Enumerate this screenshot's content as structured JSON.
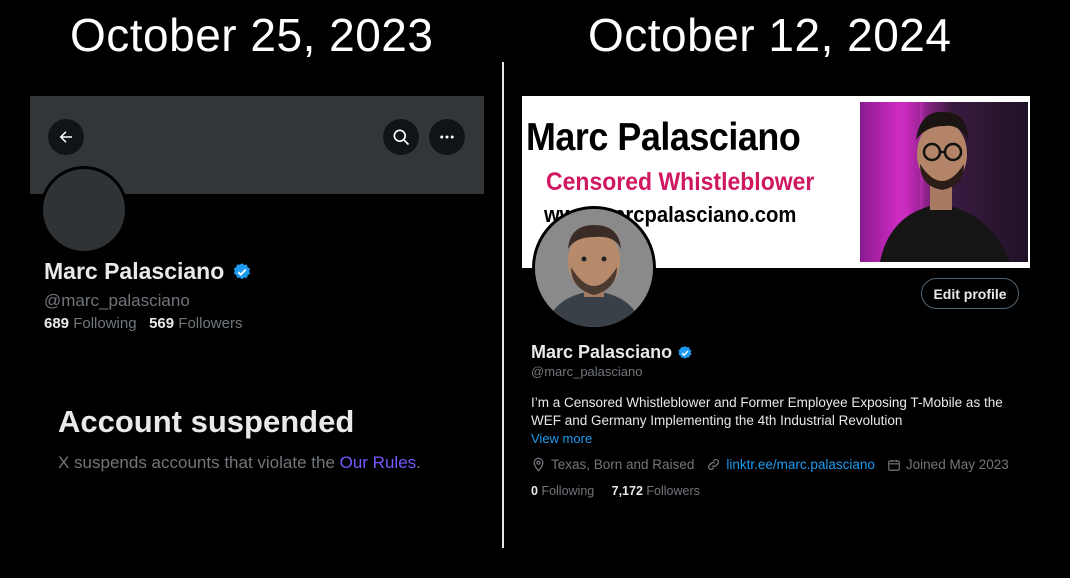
{
  "dates": {
    "left": "October 25, 2023",
    "right": "October 12, 2024"
  },
  "suspended_profile": {
    "name": "Marc Palasciano",
    "handle": "@marc_palasciano",
    "following_count": "689",
    "following_label": "Following",
    "followers_count": "569",
    "followers_label": "Followers",
    "suspended_title": "Account suspended",
    "suspended_text_prefix": "X suspends accounts that violate the ",
    "suspended_link": "Our Rules",
    "suspended_text_suffix": "."
  },
  "active_profile": {
    "banner": {
      "name": "Marc Palasciano",
      "subtitle": "Censored Whistleblower",
      "url": "www.marcpalasciano.com"
    },
    "edit_button": "Edit profile",
    "name": "Marc Palasciano",
    "handle": "@marc_palasciano",
    "bio_line1": "I’m a Censored Whistleblower and Former Employee Exposing T-Mobile as the",
    "bio_line2": "WEF and Germany Implementing the 4th Industrial Revolution",
    "view_more": "View more",
    "location": "Texas, Born and Raised",
    "link": "linktr.ee/marc.palasciano",
    "joined": "Joined May 2023",
    "following_count": "0",
    "following_label": "Following",
    "followers_count": "7,172",
    "followers_label": "Followers"
  },
  "colors": {
    "verified": "#1d9bf0",
    "link": "#1d9bf0",
    "rules_link": "#7856ff",
    "banner_subtitle": "#d01761"
  },
  "icons": [
    "back-arrow-icon",
    "search-icon",
    "more-icon",
    "verified-badge-icon",
    "location-icon",
    "link-icon",
    "calendar-icon"
  ]
}
